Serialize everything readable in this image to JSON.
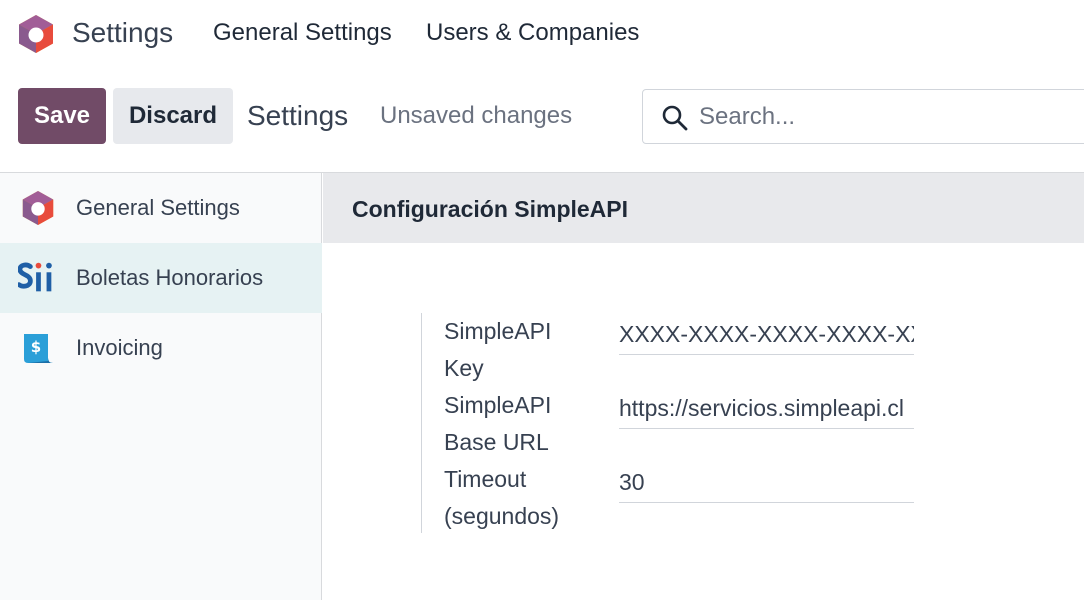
{
  "app": {
    "title": "Settings",
    "logo_icon": "odoo-hexagon-icon"
  },
  "nav": {
    "items": [
      {
        "label": "General Settings"
      },
      {
        "label": "Users & Companies"
      }
    ]
  },
  "toolbar": {
    "save_label": "Save",
    "discard_label": "Discard",
    "breadcrumb": "Settings",
    "status": "Unsaved changes"
  },
  "search": {
    "placeholder": "Search...",
    "value": ""
  },
  "sidebar": {
    "items": [
      {
        "label": "General Settings",
        "icon": "odoo-hexagon-icon",
        "active": false
      },
      {
        "label": "Boletas Honorarios",
        "icon": "sii-logo-icon",
        "active": true
      },
      {
        "label": "Invoicing",
        "icon": "invoicing-icon",
        "active": false
      }
    ]
  },
  "main": {
    "section_title": "Configuración SimpleAPI",
    "fields": [
      {
        "label": "SimpleAPI Key",
        "value": "XXXX-XXXX-XXXX-XXXX-XXXX"
      },
      {
        "label": "SimpleAPI Base URL",
        "value": "https://servicios.simpleapi.cl"
      },
      {
        "label": "Timeout (segundos)",
        "value": "30"
      }
    ]
  },
  "colors": {
    "primary": "#714b67",
    "active_sidebar": "#e6f2f3",
    "section_header": "#e8e9ec"
  }
}
